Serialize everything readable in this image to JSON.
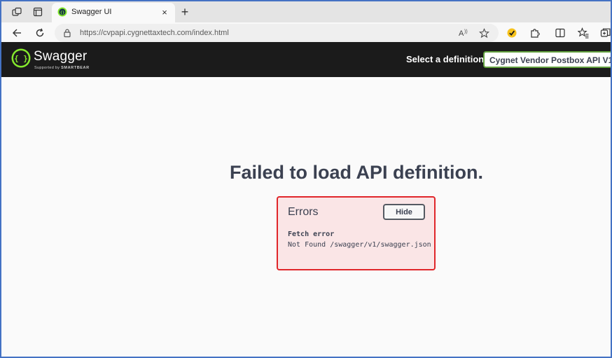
{
  "browser": {
    "tab": {
      "title": "Swagger UI",
      "close_glyph": "×"
    },
    "new_tab_glyph": "+",
    "address": {
      "url": "https://cvpapi.cygnettaxtech.com/index.html"
    },
    "icons": {
      "workspaces": "workspaces-icon",
      "tab_actions": "tab-actions-icon",
      "back": "back-arrow-icon",
      "reload": "reload-icon",
      "lock": "lock-icon",
      "read_aloud": "read-aloud-icon",
      "favorite": "star-icon",
      "extension_1": "checkmark-extension-icon",
      "extensions": "puzzle-extensions-icon",
      "split_screen": "split-screen-icon",
      "favorites": "favorites-icon",
      "collections": "collections-icon"
    }
  },
  "swagger": {
    "brand": "Swagger",
    "brand_sub_prefix": "Supported by",
    "brand_sub_name": "SMARTBEAR",
    "select_label": "Select a definition",
    "select_value": "Cygnet Vendor Postbox API V1",
    "colors": {
      "topbar": "#1b1b1b",
      "accent": "#85ea2d",
      "select_border": "#62a03f"
    }
  },
  "content": {
    "headline": "Failed to load API definition.",
    "errors": {
      "title": "Errors",
      "hide_label": "Hide",
      "error_type": "Fetch error",
      "error_message": "Not Found /swagger/v1/swagger.json",
      "colors": {
        "background": "#fae5e6",
        "border": "#e0262a"
      }
    }
  }
}
